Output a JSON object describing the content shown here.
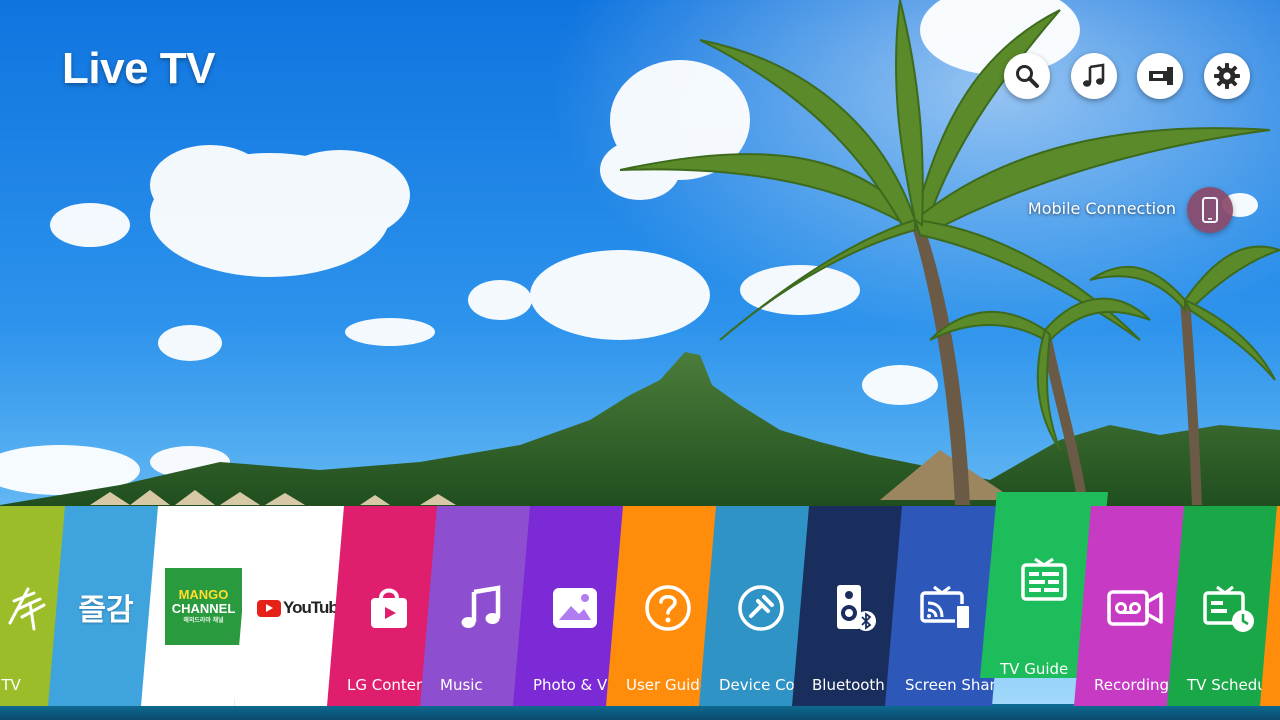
{
  "header": {
    "title": "Live TV"
  },
  "top_buttons": [
    {
      "name": "search",
      "icon": "search-icon"
    },
    {
      "name": "music",
      "icon": "music-note-icon"
    },
    {
      "name": "input",
      "icon": "input-source-icon"
    },
    {
      "name": "settings",
      "icon": "gear-icon"
    }
  ],
  "mobile_connection": {
    "label": "Mobile Connection",
    "icon": "mobile-phone-icon"
  },
  "launcher": {
    "cards": [
      {
        "label": "Live TV",
        "color": "#9bbd2a",
        "icon": "antenna-icon"
      },
      {
        "label": "",
        "color": "#3fa3dd",
        "icon": "jul-gam-logo",
        "logo_text": "즐감"
      },
      {
        "label": "",
        "color": "#ffffff",
        "icon": "mango-channel-logo",
        "logo_lines": [
          "MANGO",
          "CHANNEL",
          "해외드라마 채널"
        ]
      },
      {
        "label": "",
        "color": "#ffffff",
        "icon": "youtube-logo",
        "logo_text": "YouTube"
      },
      {
        "label": "LG Content Store",
        "color": "#df1f6d",
        "icon": "shopping-bag-icon"
      },
      {
        "label": "Music",
        "color": "#8d4fcf",
        "icon": "music-note-icon"
      },
      {
        "label": "Photo & Video",
        "color": "#7b2ad6",
        "icon": "photo-icon"
      },
      {
        "label": "User Guide",
        "color": "#ff8d0b",
        "icon": "question-icon"
      },
      {
        "label": "Device Connector",
        "color": "#2f93c6",
        "icon": "device-connector-icon"
      },
      {
        "label": "Bluetooth",
        "color": "#1a2e5e",
        "icon": "bluetooth-speaker-icon"
      },
      {
        "label": "Screen Share",
        "color": "#2e57ba",
        "icon": "screen-share-icon"
      },
      {
        "label": "TV Guide",
        "color": "#1dbd5b",
        "icon": "tv-guide-icon"
      },
      {
        "label": "Recordings",
        "color": "#c73ac4",
        "icon": "recording-icon"
      },
      {
        "label": "TV Scheduler",
        "color": "#1aa748",
        "icon": "tv-scheduler-icon"
      },
      {
        "label": "",
        "color": "#ff8d0b",
        "icon": ""
      }
    ]
  }
}
